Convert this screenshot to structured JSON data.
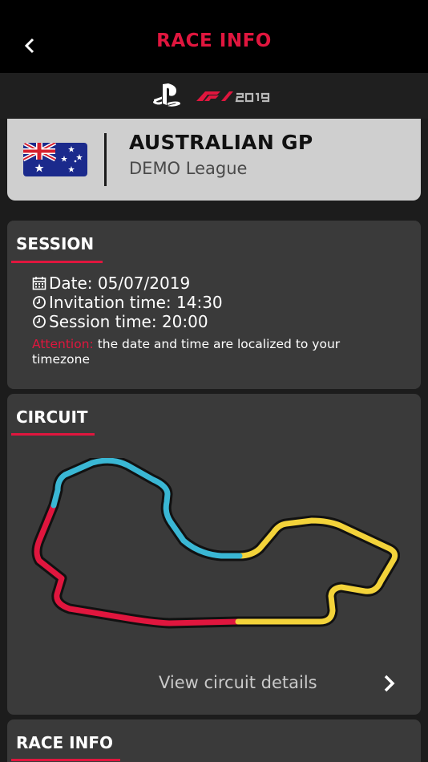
{
  "header": {
    "title": "RACE INFO",
    "back_icon": "chevron-left-icon"
  },
  "logo_bar": {
    "platform_icon": "playstation-logo-icon",
    "game_logo": "f1-2019-logo"
  },
  "event": {
    "flag": "australia-flag-icon",
    "title": "AUSTRALIAN GP",
    "league": "DEMO League"
  },
  "session": {
    "heading": "SESSION",
    "date": "Date: 05/07/2019",
    "invitation_time": "Invitation time: 14:30",
    "session_time": "Session time: 20:00",
    "notice_label": "Attention:",
    "notice_text": " the date and time are localized to your timezone"
  },
  "circuit": {
    "heading": "CIRCUIT",
    "details_link": "View circuit details",
    "sector_colors": [
      "#e0163e",
      "#3ab7d4",
      "#f3d33a"
    ]
  },
  "race_info": {
    "heading": "RACE INFO"
  },
  "colors": {
    "accent": "#e0163e",
    "header_bg": "#000000",
    "panel_bg": "#3a3a3a",
    "card_bg": "#cfcfcf"
  }
}
